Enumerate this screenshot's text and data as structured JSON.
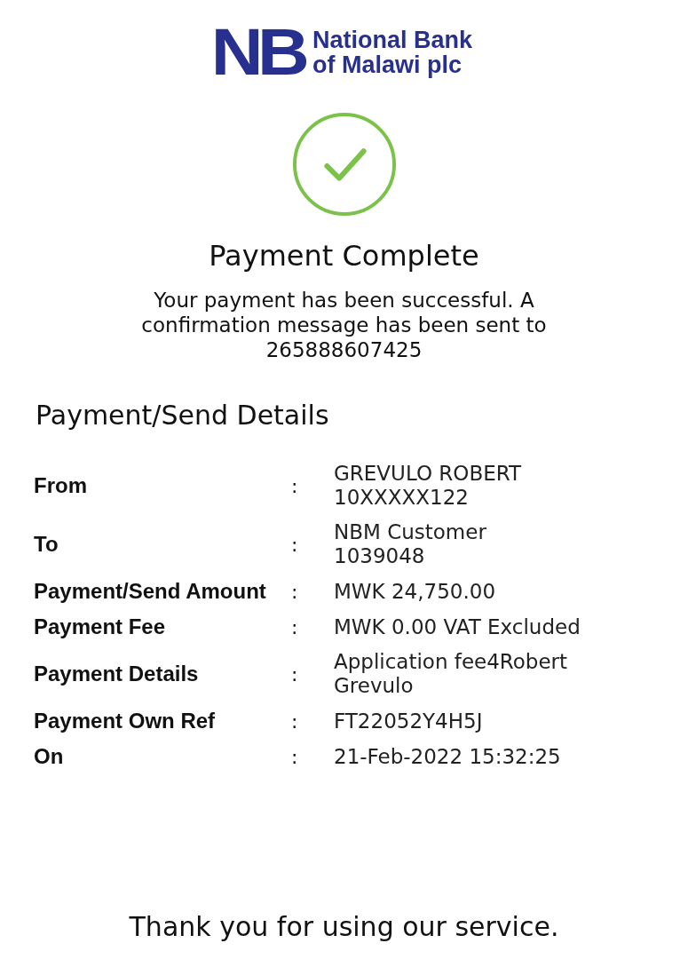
{
  "logo": {
    "mark": "NB",
    "name_lines": [
      "National Bank",
      "of Malawi plc"
    ]
  },
  "status": {
    "kind": "success",
    "title": "Payment Complete",
    "message": "Your payment has been successful. A confirmation message has been sent to 265888607425"
  },
  "details": {
    "heading": "Payment/Send Details",
    "rows": [
      {
        "label": "From",
        "separator": ":",
        "value_lines": [
          "GREVULO ROBERT",
          "10XXXXX122"
        ]
      },
      {
        "label": "To",
        "separator": ":",
        "value_lines": [
          "NBM Customer",
          "1039048"
        ]
      },
      {
        "label": "Payment/Send Amount",
        "separator": ":",
        "value_lines": [
          "MWK 24,750.00"
        ]
      },
      {
        "label": "Payment Fee",
        "separator": ":",
        "value_lines": [
          "MWK 0.00 VAT Excluded"
        ]
      },
      {
        "label": "Payment Details",
        "separator": ":",
        "value_lines": [
          "Application fee4Robert",
          "Grevulo"
        ]
      },
      {
        "label": "Payment Own Ref",
        "separator": ":",
        "value_lines": [
          "FT22052Y4H5J"
        ]
      },
      {
        "label": "On",
        "separator": ":",
        "value_lines": [
          "21-Feb-2022 15:32:25"
        ]
      }
    ]
  },
  "footer": "Thank you for using our service."
}
